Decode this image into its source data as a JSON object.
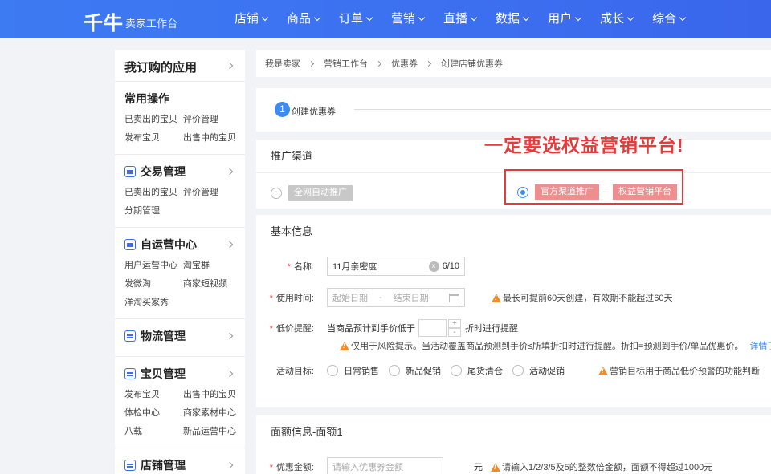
{
  "app": {
    "logo": "千牛",
    "subtitle": "卖家工作台"
  },
  "nav": [
    "店铺",
    "商品",
    "订单",
    "营销",
    "直播",
    "数据",
    "用户",
    "成长",
    "综合"
  ],
  "sidebar": {
    "header": "我订购的应用",
    "common": {
      "title": "常用操作",
      "links": [
        "已卖出的宝贝",
        "评价管理",
        "发布宝贝",
        "出售中的宝贝"
      ]
    },
    "sections": [
      {
        "title": "交易管理",
        "links": [
          "已卖出的宝贝",
          "评价管理",
          "分期管理"
        ]
      },
      {
        "title": "自运营中心",
        "links": [
          "用户运营中心",
          "淘宝群",
          "发微淘",
          "商家短视频",
          "洋淘买家秀"
        ]
      },
      {
        "title": "物流管理",
        "links": []
      },
      {
        "title": "宝贝管理",
        "links": [
          "发布宝贝",
          "出售中的宝贝",
          "体检中心",
          "商家素材中心",
          "八载",
          "新品运营中心"
        ]
      },
      {
        "title": "店铺管理",
        "links": []
      }
    ]
  },
  "breadcrumb": [
    "我是卖家",
    "营销工作台",
    "优惠券",
    "创建店铺优惠券"
  ],
  "step": {
    "number": "1",
    "label": "创建优惠券"
  },
  "channel": {
    "title": "推广渠道",
    "option_all": "全网自动推广",
    "option_official": "官方渠道推广",
    "option_platform": "权益营销平台"
  },
  "annotation": "一定要选权益营销平台!",
  "basic": {
    "title": "基本信息",
    "name_label": "名称:",
    "name_value": "11月亲密度",
    "name_count": "6/10",
    "time_label": "使用时间:",
    "start_placeholder": "起始日期",
    "date_sep": "-",
    "end_placeholder": "结束日期",
    "time_note": "最长可提前60天创建，有效期不能超过60天",
    "price_label": "低价提醒:",
    "price_prefix": "当商品预计到手价低于",
    "price_suffix": "折时进行提醒",
    "price_note": "仅用于风险提示。当活动覆盖商品预测到手价≤所填折扣时进行提醒。折扣=预测到手价/单品优惠价。",
    "price_more": "详情了解更多",
    "goal_label": "活动目标:",
    "goals": [
      "日常销售",
      "新品促销",
      "尾货清仓",
      "活动促销"
    ],
    "goal_note": "营销目标用于商品低价预警的功能判断"
  },
  "amount": {
    "title": "面额信息-面额1",
    "label": "优惠金额:",
    "placeholder": "请输入优惠券金额",
    "unit": "元",
    "note": "请输入1/2/3/5及5的整数倍金额，面额不得超过1000元"
  }
}
